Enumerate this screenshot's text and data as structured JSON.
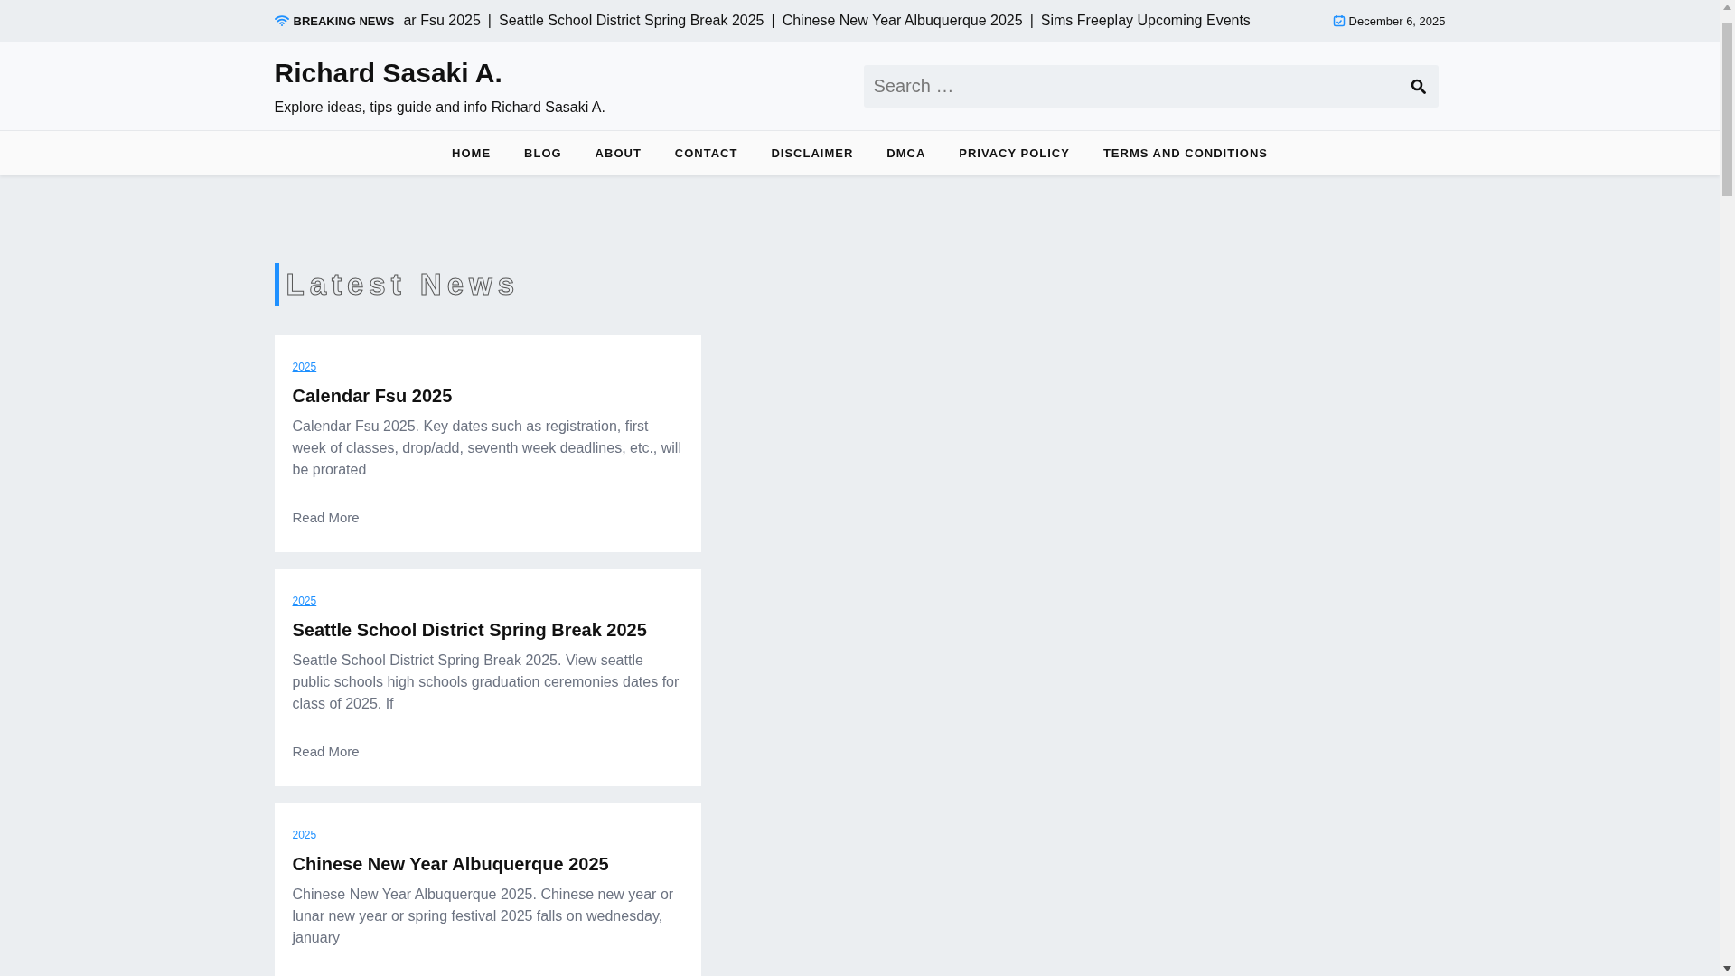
{
  "top_bar": {
    "label": "BREAKING NEWS",
    "separator": "|",
    "headlines": [
      "ar Fsu 2025",
      "Seattle School District Spring Break 2025",
      "Chinese New Year Albuquerque 2025",
      "Sims Freeplay Upcoming Events"
    ],
    "date": "December 6, 2025"
  },
  "header": {
    "site_title": "Richard Sasaki A.",
    "tagline": "Explore ideas, tips guide and info Richard Sasaki A.",
    "search": {
      "placeholder": "Search …"
    }
  },
  "nav": [
    "HOME",
    "BLOG",
    "ABOUT",
    "CONTACT",
    "DISCLAIMER",
    "DMCA",
    "PRIVACY POLICY",
    "TERMS AND CONDITIONS"
  ],
  "section_title": "Latest News",
  "posts": [
    {
      "category": "2025",
      "title": "Calendar Fsu 2025",
      "excerpt": "Calendar Fsu 2025. Key dates such as registration, first week of classes, drop/add, seventh week deadlines, etc., will be prorated",
      "read_more": "Read More"
    },
    {
      "category": "2025",
      "title": "Seattle School District Spring Break 2025",
      "excerpt": "Seattle School District Spring Break 2025. View seattle public schools high schools graduation ceremonies dates for class of 2025. If",
      "read_more": "Read More"
    },
    {
      "category": "2025",
      "title": "Chinese New Year Albuquerque 2025",
      "excerpt": "Chinese New Year Albuquerque 2025. Chinese new year or lunar new year or spring festival 2025 falls on wednesday, january"
    }
  ]
}
